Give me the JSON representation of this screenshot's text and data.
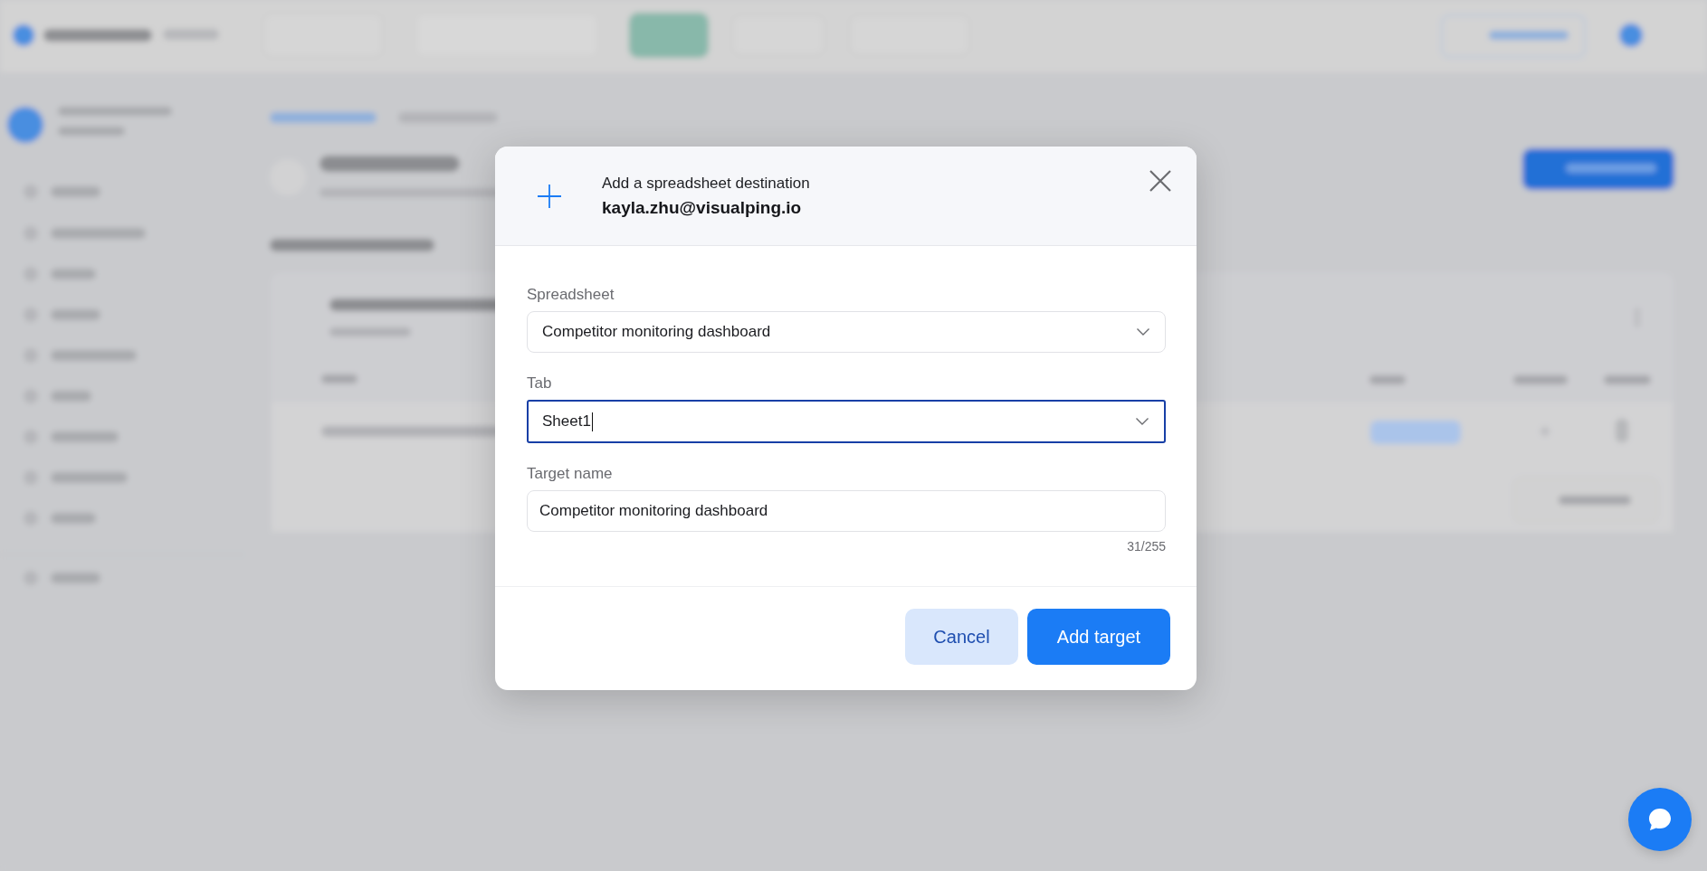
{
  "dialog": {
    "title": "Add a spreadsheet destination",
    "subtitle": "kayla.zhu@visualping.io",
    "fields": [
      {
        "label": "Spreadsheet",
        "value": "Competitor monitoring dashboard",
        "kind": "select",
        "focused": false
      },
      {
        "label": "Tab",
        "value": "Sheet1",
        "kind": "select",
        "focused": true
      },
      {
        "label": "Target name",
        "value": "Competitor monitoring dashboard",
        "kind": "text",
        "focused": false,
        "counter": "31/255"
      }
    ],
    "buttons": [
      {
        "label": "Cancel",
        "kind": "secondary"
      },
      {
        "label": "Add target",
        "kind": "primary"
      }
    ]
  }
}
